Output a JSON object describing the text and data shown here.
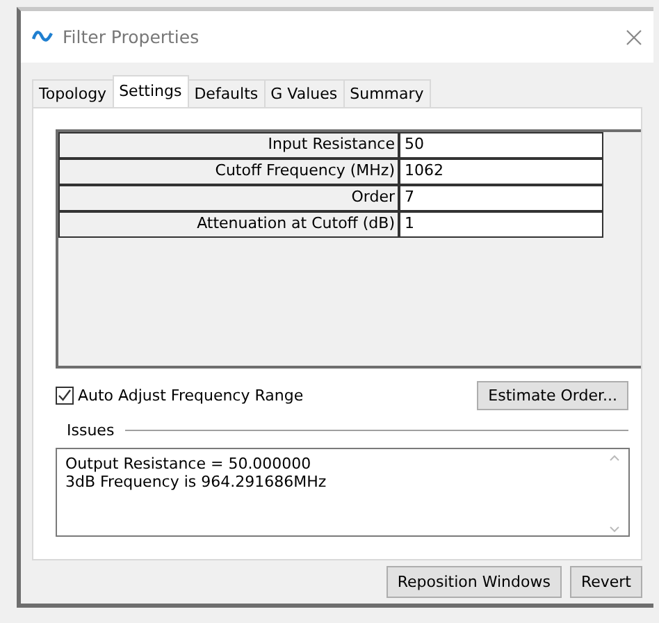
{
  "window": {
    "title": "Filter Properties"
  },
  "tabs": [
    {
      "label": "Topology",
      "selected": false
    },
    {
      "label": "Settings",
      "selected": true
    },
    {
      "label": "Defaults",
      "selected": false
    },
    {
      "label": "G Values",
      "selected": false
    },
    {
      "label": "Summary",
      "selected": false
    }
  ],
  "properties": [
    {
      "name": "Input Resistance",
      "value": "50"
    },
    {
      "name": "Cutoff Frequency (MHz)",
      "value": "1062"
    },
    {
      "name": "Order",
      "value": "7"
    },
    {
      "name": "Attenuation at Cutoff (dB)",
      "value": "1"
    }
  ],
  "auto_adjust": {
    "label": "Auto Adjust Frequency Range",
    "checked": true
  },
  "estimate_button": "Estimate Order...",
  "issues": {
    "title": "Issues",
    "lines": [
      "Output Resistance = 50.000000",
      "3dB Frequency is 964.291686MHz"
    ]
  },
  "buttons": [
    "Reposition Windows",
    "Revert"
  ]
}
